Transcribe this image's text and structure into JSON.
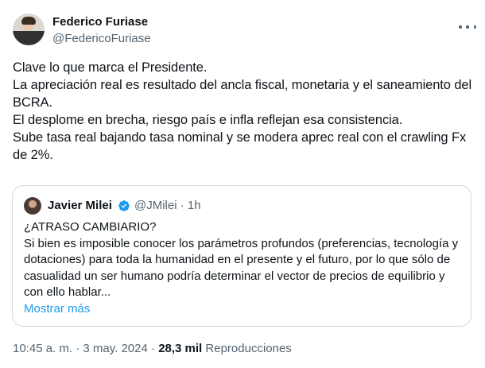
{
  "author": {
    "name": "Federico Furiase",
    "handle": "@FedericoFuriase"
  },
  "tweet_text": "Clave lo que marca el Presidente.\nLa apreciación real es resultado del ancla fiscal, monetaria y el saneamiento del BCRA.\nEl desplome en brecha, riesgo país e infla reflejan esa consistencia.\nSube tasa real bajando tasa nominal y se modera aprec real con el crawling Fx de 2%.",
  "quoted": {
    "name": "Javier Milei",
    "handle": "@JMilei",
    "separator": "·",
    "time": "1h",
    "text": "¿ATRASO CAMBIARIO?\nSi bien es imposible conocer los parámetros profundos (preferencias, tecnología y dotaciones) para toda la humanidad en el presente y el futuro, por lo que sólo de casualidad un ser humano podría determinar el vector de precios de equilibrio y con ello hablar...",
    "show_more": "Mostrar más"
  },
  "meta": {
    "time": "10:45 a. m.",
    "separator1": "·",
    "date": "3 may. 2024",
    "separator2": "·",
    "views_count": "28,3 mil",
    "views_label": "Reproducciones"
  },
  "icons": {
    "verified": "verified-badge-icon",
    "more": "more-icon"
  },
  "colors": {
    "text": "#0f1419",
    "secondary": "#536471",
    "accent": "#1d9bf0",
    "border": "#cfd9de"
  }
}
